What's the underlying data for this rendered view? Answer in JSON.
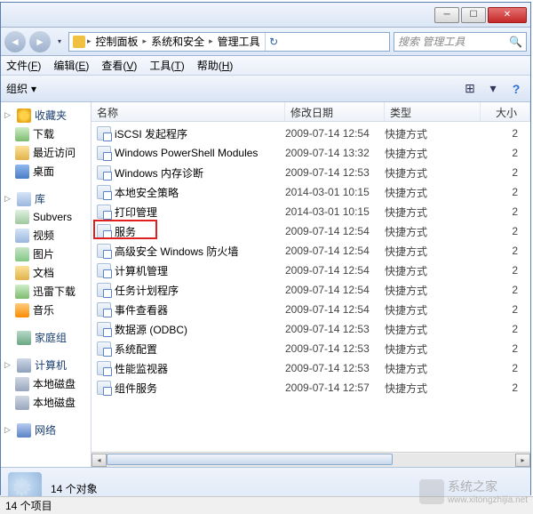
{
  "titlebar": {
    "min": "─",
    "max": "☐",
    "close": "✕"
  },
  "nav": {
    "breadcrumb": [
      "控制面板",
      "系统和安全",
      "管理工具"
    ],
    "search_placeholder": "搜索 管理工具",
    "refresh": "↻"
  },
  "menubar": [
    {
      "label": "文件",
      "accel": "F"
    },
    {
      "label": "编辑",
      "accel": "E"
    },
    {
      "label": "查看",
      "accel": "V"
    },
    {
      "label": "工具",
      "accel": "T"
    },
    {
      "label": "帮助",
      "accel": "H"
    }
  ],
  "toolbar": {
    "organize": "组织",
    "dd": "▾",
    "view": "⊞",
    "help": "?"
  },
  "sidebar": {
    "favorites": {
      "title": "收藏夹",
      "items": [
        "下载",
        "最近访问",
        "桌面"
      ]
    },
    "libraries": {
      "title": "库",
      "items": [
        "Subvers",
        "视频",
        "图片",
        "文档",
        "迅雷下载",
        "音乐"
      ]
    },
    "homegroup": {
      "title": "家庭组"
    },
    "computer": {
      "title": "计算机",
      "items": [
        "本地磁盘",
        "本地磁盘"
      ]
    },
    "network": {
      "title": "网络"
    }
  },
  "columns": {
    "name": "名称",
    "date": "修改日期",
    "type": "类型",
    "size": "大小"
  },
  "files": [
    {
      "name": "iSCSI 发起程序",
      "date": "2009-07-14 12:54",
      "type": "快捷方式",
      "size": "2"
    },
    {
      "name": "Windows PowerShell Modules",
      "date": "2009-07-14 13:32",
      "type": "快捷方式",
      "size": "2"
    },
    {
      "name": "Windows 内存诊断",
      "date": "2009-07-14 12:53",
      "type": "快捷方式",
      "size": "2"
    },
    {
      "name": "本地安全策略",
      "date": "2014-03-01 10:15",
      "type": "快捷方式",
      "size": "2"
    },
    {
      "name": "打印管理",
      "date": "2014-03-01 10:15",
      "type": "快捷方式",
      "size": "2"
    },
    {
      "name": "服务",
      "date": "2009-07-14 12:54",
      "type": "快捷方式",
      "size": "2",
      "highlighted": true
    },
    {
      "name": "高级安全 Windows 防火墙",
      "date": "2009-07-14 12:54",
      "type": "快捷方式",
      "size": "2"
    },
    {
      "name": "计算机管理",
      "date": "2009-07-14 12:54",
      "type": "快捷方式",
      "size": "2"
    },
    {
      "name": "任务计划程序",
      "date": "2009-07-14 12:54",
      "type": "快捷方式",
      "size": "2"
    },
    {
      "name": "事件查看器",
      "date": "2009-07-14 12:54",
      "type": "快捷方式",
      "size": "2"
    },
    {
      "name": "数据源 (ODBC)",
      "date": "2009-07-14 12:53",
      "type": "快捷方式",
      "size": "2"
    },
    {
      "name": "系统配置",
      "date": "2009-07-14 12:53",
      "type": "快捷方式",
      "size": "2"
    },
    {
      "name": "性能监视器",
      "date": "2009-07-14 12:53",
      "type": "快捷方式",
      "size": "2"
    },
    {
      "name": "组件服务",
      "date": "2009-07-14 12:57",
      "type": "快捷方式",
      "size": "2"
    }
  ],
  "details": {
    "count": "14 个对象"
  },
  "statusbar": {
    "items": "14 个项目"
  },
  "watermark": {
    "name": "系统之家",
    "url": "www.xitongzhijia.net"
  }
}
